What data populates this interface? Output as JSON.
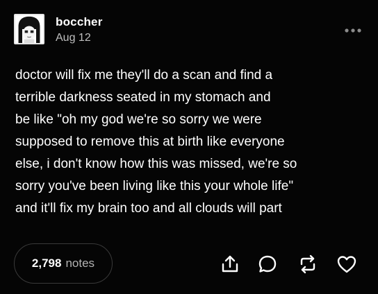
{
  "post": {
    "username": "boccher",
    "date": "Aug 12",
    "body_lines": [
      "doctor will fix me they'll do a scan and find a",
      "terrible darkness seated in my stomach and",
      "be like \"oh my god we're so sorry we were",
      "supposed to remove this at birth like everyone",
      "else, i don't know how this was missed, we're so",
      "sorry you've been living like this your whole life\"",
      "and it'll fix my brain too and all clouds will part"
    ],
    "notes_count": "2,798",
    "notes_label": "notes"
  },
  "icons": {
    "avatar": "anime-avatar",
    "more": "more-dots-icon",
    "share": "share-icon",
    "reply": "reply-icon",
    "reblog": "reblog-icon",
    "like": "heart-icon"
  },
  "colors": {
    "background": "#000000",
    "text": "#ffffff",
    "muted": "#b3b3b3",
    "border": "#3a3a3a"
  }
}
